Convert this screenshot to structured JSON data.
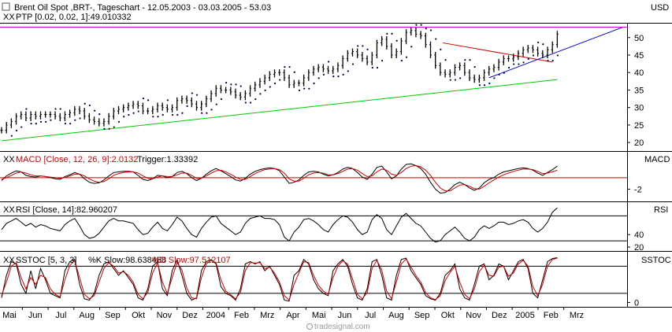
{
  "chart_data": [
    {
      "type": "line",
      "panel": "price",
      "title": "Brent Oil Spot ,BRT-, Tageschart - 12.05.2003 - 03.03.2005 - 53.03",
      "indicator_label": "PTP [0.02, 0.02, 1]:49.010332",
      "currency_label": "USD",
      "y_ticks": [
        20,
        25,
        30,
        35,
        40,
        45,
        50
      ],
      "ylim": [
        18,
        54
      ],
      "x_ticks": [
        "Mai",
        "Jun",
        "Jul",
        "Aug",
        "Sep",
        "Okt",
        "Nov",
        "Dez",
        "2004",
        "Feb",
        "Mrz",
        "Apr",
        "Mai",
        "Jun",
        "Jul",
        "Aug",
        "Sep",
        "Okt",
        "Nov",
        "Dez",
        "2005",
        "Feb",
        "Mrz"
      ],
      "series": [
        {
          "kind": "price",
          "x": [
            0,
            4,
            8,
            12,
            16,
            20,
            24,
            28,
            32,
            36,
            40,
            44,
            48,
            52,
            56,
            60,
            64,
            68,
            72,
            76,
            80,
            84,
            88,
            92,
            96,
            100,
            104,
            108,
            112,
            116,
            120,
            124,
            128,
            132,
            136,
            140,
            144,
            148,
            152,
            156,
            160,
            164,
            168,
            172,
            176,
            180,
            184,
            188,
            192,
            196,
            200,
            204,
            208,
            212,
            216,
            220,
            224,
            228,
            232,
            236,
            240,
            244,
            248,
            252,
            256,
            260,
            264,
            268,
            272,
            276,
            280,
            284,
            288,
            292,
            296,
            300,
            304,
            308,
            312,
            316,
            320,
            324,
            328,
            332,
            336,
            340,
            344,
            348,
            352,
            356,
            360,
            364,
            368,
            372,
            376,
            380,
            384,
            388,
            392,
            396,
            400,
            404,
            408,
            412,
            416,
            420,
            424,
            428,
            432,
            436,
            440,
            444,
            448,
            452,
            456
          ],
          "y": [
            23.5,
            25,
            26,
            27.5,
            28,
            27,
            28,
            27.5,
            28,
            28,
            28,
            27.5,
            27,
            28,
            28.5,
            29.5,
            29,
            27.5,
            26.5,
            26,
            25.5,
            26,
            27.5,
            29,
            29.5,
            30,
            30.5,
            31,
            30.5,
            29,
            29,
            29.5,
            30.5,
            30,
            29.5,
            30,
            32,
            32.5,
            32,
            31,
            30,
            31,
            32.5,
            34,
            35.5,
            35,
            35,
            34.5,
            33.5,
            33,
            34,
            35.5,
            36.5,
            37.5,
            38.5,
            39.5,
            40,
            40,
            38.5,
            36.5,
            37,
            37,
            38.5,
            40,
            41,
            41.5,
            41,
            40.5,
            41,
            42,
            44,
            45.5,
            46,
            45,
            44,
            43,
            45,
            48.5,
            49.5,
            47.5,
            45,
            46,
            49,
            51.5,
            52,
            51,
            50.5,
            48,
            45,
            42,
            40,
            39.5,
            40,
            41.5,
            42,
            40,
            38.5,
            38,
            38.5,
            40,
            41,
            41.5,
            43,
            44,
            44,
            44.5,
            45.5,
            46.5,
            47,
            46.5,
            45.5,
            45,
            46.5,
            48,
            51
          ]
        },
        {
          "kind": "trendline-support",
          "color": "#00cc00",
          "x": [
            0,
            456
          ],
          "y": [
            20.5,
            38
          ]
        },
        {
          "kind": "trendline-resistance",
          "color": "#cc0000",
          "x": [
            362,
            452
          ],
          "y": [
            48.5,
            43
          ]
        },
        {
          "kind": "trendline-blue",
          "color": "#0000cc",
          "x": [
            400,
            510
          ],
          "y": [
            38.5,
            53
          ]
        },
        {
          "kind": "hline",
          "color": "#cc00cc",
          "y": 53
        }
      ]
    },
    {
      "type": "line",
      "panel": "macd",
      "indicator_label": "MACD [Close, 12, 26, 9]:2.0132",
      "trigger_label": "Trigger:1.33392",
      "axis_label": "MACD",
      "y_ticks": [
        -2
      ],
      "ylim": [
        -4,
        4.5
      ],
      "series": [
        {
          "name": "MACD",
          "color": "#000000",
          "y": [
            -0.5,
            0.3,
            0.8,
            1.2,
            1.0,
            0.4,
            0.2,
            0.1,
            0.3,
            0.2,
            0.0,
            -0.2,
            -0.3,
            0.2,
            0.5,
            0.9,
            0.6,
            -0.2,
            -0.8,
            -1.0,
            -0.9,
            -0.4,
            0.3,
            0.9,
            1.0,
            1.1,
            1.1,
            1.0,
            0.4,
            -0.3,
            -0.5,
            -0.2,
            0.4,
            0.3,
            0.0,
            0.2,
            0.9,
            1.1,
            0.7,
            0.0,
            -0.5,
            -0.1,
            0.6,
            1.2,
            1.6,
            1.2,
            0.7,
            0.2,
            -0.4,
            -0.6,
            -0.1,
            0.6,
            1.1,
            1.4,
            1.6,
            1.7,
            1.6,
            1.2,
            0.1,
            -1.0,
            -0.8,
            -0.4,
            0.4,
            1.0,
            1.1,
            1.0,
            0.6,
            0.3,
            0.5,
            0.9,
            1.5,
            1.8,
            1.6,
            0.9,
            0.1,
            -0.3,
            0.6,
            1.8,
            2.0,
            1.0,
            -0.2,
            0.3,
            1.5,
            2.3,
            2.4,
            2.1,
            1.6,
            0.6,
            -0.8,
            -2.0,
            -2.7,
            -2.6,
            -2.0,
            -1.2,
            -0.8,
            -1.2,
            -1.8,
            -2.2,
            -1.8,
            -0.9,
            -0.3,
            0.0,
            0.6,
            1.0,
            1.2,
            1.4,
            1.6,
            1.7,
            1.6,
            1.3,
            0.8,
            0.4,
            0.9,
            1.4,
            2.0
          ]
        },
        {
          "name": "Trigger",
          "color": "#cc0000",
          "y": [
            -0.3,
            0.0,
            0.4,
            0.8,
            1.0,
            0.8,
            0.5,
            0.3,
            0.3,
            0.2,
            0.1,
            0.0,
            -0.1,
            0.0,
            0.3,
            0.6,
            0.6,
            0.3,
            -0.2,
            -0.6,
            -0.8,
            -0.7,
            -0.2,
            0.4,
            0.7,
            0.9,
            1.0,
            1.0,
            0.8,
            0.3,
            -0.1,
            -0.2,
            0.1,
            0.3,
            0.2,
            0.2,
            0.5,
            0.8,
            0.8,
            0.4,
            -0.1,
            -0.1,
            0.3,
            0.8,
            1.2,
            1.3,
            1.0,
            0.6,
            0.1,
            -0.3,
            -0.3,
            0.2,
            0.7,
            1.1,
            1.4,
            1.5,
            1.6,
            1.4,
            0.8,
            -0.2,
            -0.6,
            -0.6,
            -0.1,
            0.5,
            0.8,
            0.9,
            0.8,
            0.5,
            0.5,
            0.7,
            1.1,
            1.5,
            1.6,
            1.3,
            0.7,
            0.2,
            0.3,
            1.0,
            1.5,
            1.3,
            0.6,
            0.4,
            0.9,
            1.6,
            2.0,
            2.1,
            1.9,
            1.3,
            0.4,
            -0.8,
            -1.8,
            -2.3,
            -2.3,
            -1.8,
            -1.3,
            -1.2,
            -1.5,
            -1.9,
            -2.0,
            -1.5,
            -0.9,
            -0.4,
            0.1,
            0.5,
            0.8,
            1.1,
            1.3,
            1.5,
            1.5,
            1.4,
            1.1,
            0.7,
            0.8,
            1.0,
            1.3
          ]
        },
        {
          "kind": "hline",
          "color": "#cc0000",
          "y": 0
        }
      ]
    },
    {
      "type": "line",
      "panel": "rsi",
      "indicator_label": "RSI [Close, 14]:82.960207",
      "axis_label": "RSI",
      "y_ticks": [
        40,
        20
      ],
      "ylim": [
        15,
        92
      ],
      "hlines": [
        30,
        70
      ],
      "series": [
        {
          "name": "RSI",
          "color": "#000000",
          "y": [
            48,
            58,
            62,
            66,
            60,
            54,
            58,
            52,
            56,
            54,
            50,
            48,
            46,
            56,
            62,
            66,
            54,
            40,
            34,
            36,
            42,
            52,
            62,
            66,
            62,
            62,
            60,
            58,
            48,
            40,
            42,
            52,
            60,
            50,
            46,
            56,
            68,
            62,
            50,
            40,
            36,
            50,
            60,
            68,
            70,
            58,
            52,
            46,
            40,
            44,
            58,
            66,
            68,
            70,
            66,
            66,
            64,
            56,
            36,
            30,
            44,
            52,
            64,
            66,
            62,
            56,
            48,
            44,
            56,
            64,
            70,
            68,
            60,
            48,
            40,
            44,
            64,
            72,
            66,
            48,
            40,
            54,
            68,
            74,
            66,
            58,
            54,
            44,
            34,
            28,
            30,
            40,
            46,
            52,
            44,
            34,
            30,
            36,
            48,
            54,
            50,
            54,
            60,
            60,
            56,
            58,
            62,
            64,
            60,
            50,
            44,
            50,
            60,
            76,
            83
          ]
        }
      ]
    },
    {
      "type": "line",
      "panel": "sstoc",
      "indicator_label": "SSTOC [5, 3, 3]",
      "k_label": "%K Slow:98.638468",
      "d_label": "%D Slow:97.512107",
      "axis_label": "SSTOC",
      "y_ticks": [
        0
      ],
      "ylim": [
        -8,
        112
      ],
      "hlines": [
        20,
        80
      ],
      "series": [
        {
          "name": "%K Slow",
          "color": "#000000",
          "y": [
            10,
            60,
            90,
            85,
            40,
            20,
            70,
            30,
            75,
            50,
            20,
            15,
            10,
            70,
            90,
            95,
            40,
            8,
            5,
            20,
            60,
            85,
            90,
            75,
            60,
            70,
            55,
            40,
            10,
            5,
            30,
            80,
            90,
            30,
            15,
            70,
            95,
            60,
            20,
            5,
            10,
            70,
            90,
            95,
            85,
            35,
            20,
            15,
            5,
            30,
            85,
            90,
            85,
            90,
            70,
            80,
            60,
            40,
            5,
            3,
            60,
            70,
            95,
            85,
            50,
            30,
            20,
            15,
            70,
            85,
            95,
            80,
            40,
            10,
            5,
            30,
            90,
            95,
            60,
            10,
            5,
            60,
            95,
            98,
            70,
            55,
            40,
            15,
            8,
            5,
            20,
            60,
            70,
            85,
            30,
            10,
            5,
            40,
            80,
            85,
            50,
            60,
            85,
            80,
            50,
            70,
            90,
            95,
            75,
            20,
            10,
            50,
            90,
            97,
            99
          ]
        },
        {
          "name": "%D Slow",
          "color": "#cc0000",
          "y": [
            15,
            45,
            80,
            88,
            55,
            30,
            55,
            40,
            60,
            55,
            30,
            18,
            12,
            50,
            82,
            92,
            55,
            18,
            8,
            15,
            45,
            75,
            88,
            80,
            65,
            68,
            60,
            45,
            18,
            8,
            22,
            65,
            88,
            45,
            20,
            55,
            88,
            72,
            32,
            10,
            8,
            55,
            85,
            93,
            88,
            50,
            25,
            17,
            8,
            22,
            70,
            88,
            87,
            88,
            75,
            78,
            65,
            45,
            15,
            5,
            40,
            65,
            90,
            88,
            60,
            38,
            25,
            18,
            55,
            80,
            92,
            85,
            52,
            18,
            8,
            22,
            75,
            93,
            72,
            25,
            8,
            45,
            85,
            96,
            78,
            60,
            45,
            22,
            10,
            6,
            15,
            48,
            66,
            80,
            45,
            18,
            8,
            30,
            68,
            82,
            60,
            58,
            78,
            80,
            58,
            65,
            85,
            93,
            80,
            35,
            15,
            40,
            80,
            95,
            98
          ]
        }
      ]
    }
  ],
  "branding": "tradesignal.com"
}
